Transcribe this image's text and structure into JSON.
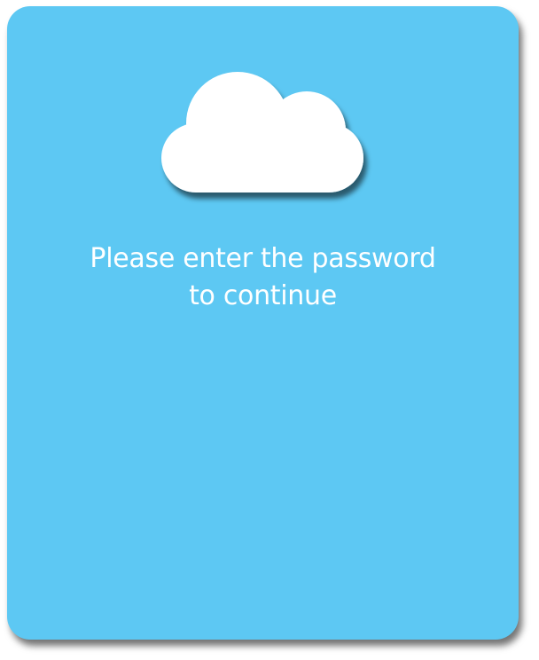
{
  "colors": {
    "card_background": "#5DC8F3",
    "cloud": "#FFFFFF",
    "text": "#FFFFFF"
  },
  "icon": "cloud-icon",
  "prompt": {
    "line1": "Please enter the password",
    "line2": "to continue"
  }
}
